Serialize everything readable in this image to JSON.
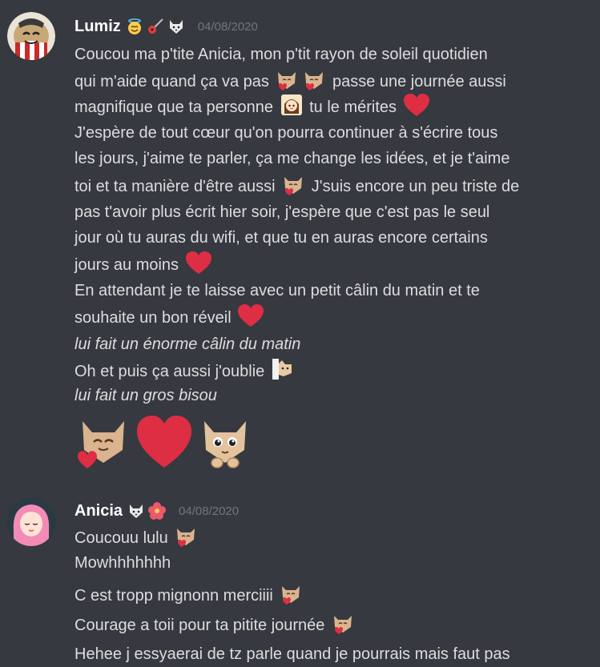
{
  "messages": [
    {
      "author": "Lumiz",
      "badges": [
        "angel-smile-icon",
        "guitar-icon",
        "wolf-icon"
      ],
      "timestamp": "04/08/2020",
      "lines": [
        [
          "Coucou ma p'tite Anicia, mon p'tit rayon de soleil quotidien"
        ],
        [
          "qui m'aide quand ça va pas",
          "passe une journée aussi"
        ],
        [
          "magnifique que ta personne",
          "tu le mérites"
        ],
        [
          "J'espère de tout cœur qu'on pourra continuer à s'écrire tous"
        ],
        [
          "les jours, j'aime te parler, ça me change les idées, et je t'aime"
        ],
        [
          "toi et ta manière d'être aussi",
          "J'suis encore un peu triste de"
        ],
        [
          "pas t'avoir plus écrit hier soir, j'espère que c'est pas le seul"
        ],
        [
          "jour où tu auras du wifi, et que tu en auras encore certains"
        ],
        [
          "jours au moins"
        ],
        [
          "En attendant je te laisse avec un petit câlin du matin et te"
        ],
        [
          "souhaite un bon réveil"
        ],
        [
          "lui fait un énorme câlin du matin"
        ],
        [
          "Oh et puis ça aussi j'oublie"
        ],
        [
          "lui fait un gros bisou"
        ]
      ]
    },
    {
      "author": "Anicia",
      "badges": [
        "wolf-icon",
        "hibiscus-icon"
      ],
      "timestamp": "04/08/2020",
      "lines": [
        [
          "Coucouu lulu"
        ],
        [
          "Mowhhhhhhh"
        ],
        [
          "C est tropp mignonn merciiii"
        ],
        [
          "Courage a toii pour ta pitite journée"
        ],
        [
          "Hehee j essyaerai de tz parle quand je pourrais mais faut pas"
        ]
      ]
    }
  ],
  "colors": {
    "background": "#36393f",
    "text": "#dcddde",
    "username": "#ffffff",
    "timestamp": "#72767d",
    "heart": "#dd2e44",
    "cat": "#d9b48f"
  }
}
